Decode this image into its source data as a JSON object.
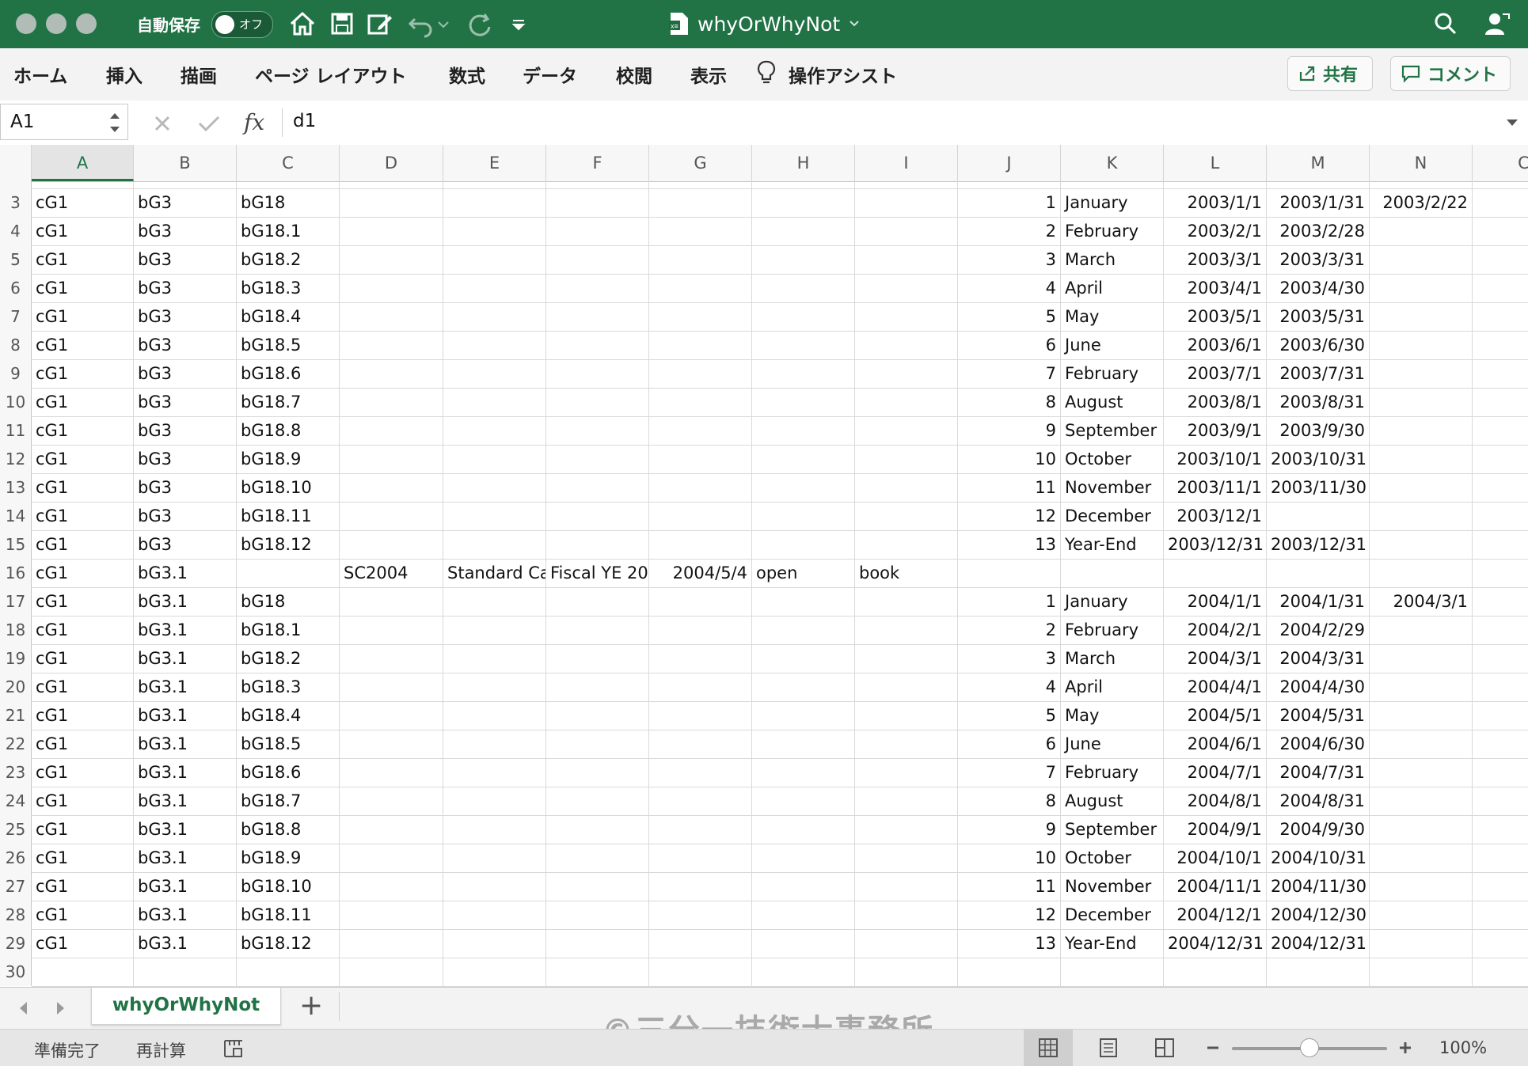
{
  "titlebar": {
    "autosave_label": "自動保存",
    "autosave_state": "オフ",
    "doc_title": "whyOrWhyNot",
    "excel_badge": "x≡"
  },
  "ribbon": {
    "tabs": [
      "ホーム",
      "挿入",
      "描画",
      "ページ レイアウト",
      "数式",
      "データ",
      "校閲",
      "表示",
      "操作アシスト"
    ],
    "share_label": "共有",
    "comment_label": "コメント"
  },
  "formula_bar": {
    "name_box": "A1",
    "formula": "d1"
  },
  "columns": [
    "A",
    "B",
    "C",
    "D",
    "E",
    "F",
    "G",
    "H",
    "I",
    "J",
    "K",
    "L",
    "M",
    "N",
    "C"
  ],
  "rows": [
    {
      "n": "3",
      "A": "cG1",
      "B": "bG3",
      "C": "bG18",
      "J": "1",
      "K": "January",
      "L": "2003/1/1",
      "M": "2003/1/31",
      "N": "2003/2/22"
    },
    {
      "n": "4",
      "A": "cG1",
      "B": "bG3",
      "C": "bG18.1",
      "J": "2",
      "K": "February",
      "L": "2003/2/1",
      "M": "2003/2/28"
    },
    {
      "n": "5",
      "A": "cG1",
      "B": "bG3",
      "C": "bG18.2",
      "J": "3",
      "K": "March",
      "L": "2003/3/1",
      "M": "2003/3/31"
    },
    {
      "n": "6",
      "A": "cG1",
      "B": "bG3",
      "C": "bG18.3",
      "J": "4",
      "K": "April",
      "L": "2003/4/1",
      "M": "2003/4/30"
    },
    {
      "n": "7",
      "A": "cG1",
      "B": "bG3",
      "C": "bG18.4",
      "J": "5",
      "K": "May",
      "L": "2003/5/1",
      "M": "2003/5/31"
    },
    {
      "n": "8",
      "A": "cG1",
      "B": "bG3",
      "C": "bG18.5",
      "J": "6",
      "K": "June",
      "L": "2003/6/1",
      "M": "2003/6/30"
    },
    {
      "n": "9",
      "A": "cG1",
      "B": "bG3",
      "C": "bG18.6",
      "J": "7",
      "K": "February",
      "L": "2003/7/1",
      "M": "2003/7/31"
    },
    {
      "n": "10",
      "A": "cG1",
      "B": "bG3",
      "C": "bG18.7",
      "J": "8",
      "K": "August",
      "L": "2003/8/1",
      "M": "2003/8/31"
    },
    {
      "n": "11",
      "A": "cG1",
      "B": "bG3",
      "C": "bG18.8",
      "J": "9",
      "K": "September",
      "L": "2003/9/1",
      "M": "2003/9/30"
    },
    {
      "n": "12",
      "A": "cG1",
      "B": "bG3",
      "C": "bG18.9",
      "J": "10",
      "K": "October",
      "L": "2003/10/1",
      "M": "2003/10/31"
    },
    {
      "n": "13",
      "A": "cG1",
      "B": "bG3",
      "C": "bG18.10",
      "J": "11",
      "K": "November",
      "L": "2003/11/1",
      "M": "2003/11/30"
    },
    {
      "n": "14",
      "A": "cG1",
      "B": "bG3",
      "C": "bG18.11",
      "J": "12",
      "K": "December",
      "L": "2003/12/1"
    },
    {
      "n": "15",
      "A": "cG1",
      "B": "bG3",
      "C": "bG18.12",
      "J": "13",
      "K": "Year-End",
      "L": "2003/12/31",
      "M": "2003/12/31"
    },
    {
      "n": "16",
      "A": "cG1",
      "B": "bG3.1",
      "D": "SC2004",
      "E": "Standard Ca",
      "F": "Fiscal YE 20",
      "G": "2004/5/4",
      "H": "open",
      "I": "book"
    },
    {
      "n": "17",
      "A": "cG1",
      "B": "bG3.1",
      "C": "bG18",
      "J": "1",
      "K": "January",
      "L": "2004/1/1",
      "M": "2004/1/31",
      "N": "2004/3/1"
    },
    {
      "n": "18",
      "A": "cG1",
      "B": "bG3.1",
      "C": "bG18.1",
      "J": "2",
      "K": "February",
      "L": "2004/2/1",
      "M": "2004/2/29"
    },
    {
      "n": "19",
      "A": "cG1",
      "B": "bG3.1",
      "C": "bG18.2",
      "J": "3",
      "K": "March",
      "L": "2004/3/1",
      "M": "2004/3/31"
    },
    {
      "n": "20",
      "A": "cG1",
      "B": "bG3.1",
      "C": "bG18.3",
      "J": "4",
      "K": "April",
      "L": "2004/4/1",
      "M": "2004/4/30"
    },
    {
      "n": "21",
      "A": "cG1",
      "B": "bG3.1",
      "C": "bG18.4",
      "J": "5",
      "K": "May",
      "L": "2004/5/1",
      "M": "2004/5/31"
    },
    {
      "n": "22",
      "A": "cG1",
      "B": "bG3.1",
      "C": "bG18.5",
      "J": "6",
      "K": "June",
      "L": "2004/6/1",
      "M": "2004/6/30"
    },
    {
      "n": "23",
      "A": "cG1",
      "B": "bG3.1",
      "C": "bG18.6",
      "J": "7",
      "K": "February",
      "L": "2004/7/1",
      "M": "2004/7/31"
    },
    {
      "n": "24",
      "A": "cG1",
      "B": "bG3.1",
      "C": "bG18.7",
      "J": "8",
      "K": "August",
      "L": "2004/8/1",
      "M": "2004/8/31"
    },
    {
      "n": "25",
      "A": "cG1",
      "B": "bG3.1",
      "C": "bG18.8",
      "J": "9",
      "K": "September",
      "L": "2004/9/1",
      "M": "2004/9/30"
    },
    {
      "n": "26",
      "A": "cG1",
      "B": "bG3.1",
      "C": "bG18.9",
      "J": "10",
      "K": "October",
      "L": "2004/10/1",
      "M": "2004/10/31"
    },
    {
      "n": "27",
      "A": "cG1",
      "B": "bG3.1",
      "C": "bG18.10",
      "J": "11",
      "K": "November",
      "L": "2004/11/1",
      "M": "2004/11/30"
    },
    {
      "n": "28",
      "A": "cG1",
      "B": "bG3.1",
      "C": "bG18.11",
      "J": "12",
      "K": "December",
      "L": "2004/12/1",
      "M": "2004/12/30"
    },
    {
      "n": "29",
      "A": "cG1",
      "B": "bG3.1",
      "C": "bG18.12",
      "J": "13",
      "K": "Year-End",
      "L": "2004/12/31",
      "M": "2004/12/31"
    },
    {
      "n": "30"
    }
  ],
  "right_aligned_columns": [
    "G",
    "J",
    "L",
    "M",
    "N"
  ],
  "sheet_tabs": {
    "active": "whyOrWhyNot",
    "add_label": "+"
  },
  "watermark": "©三分一技術士事務所",
  "status": {
    "ready": "準備完了",
    "recalc": "再計算",
    "zoom": "100%"
  },
  "colors": {
    "accent": "#217346",
    "grid_line": "#d9d9d9"
  }
}
